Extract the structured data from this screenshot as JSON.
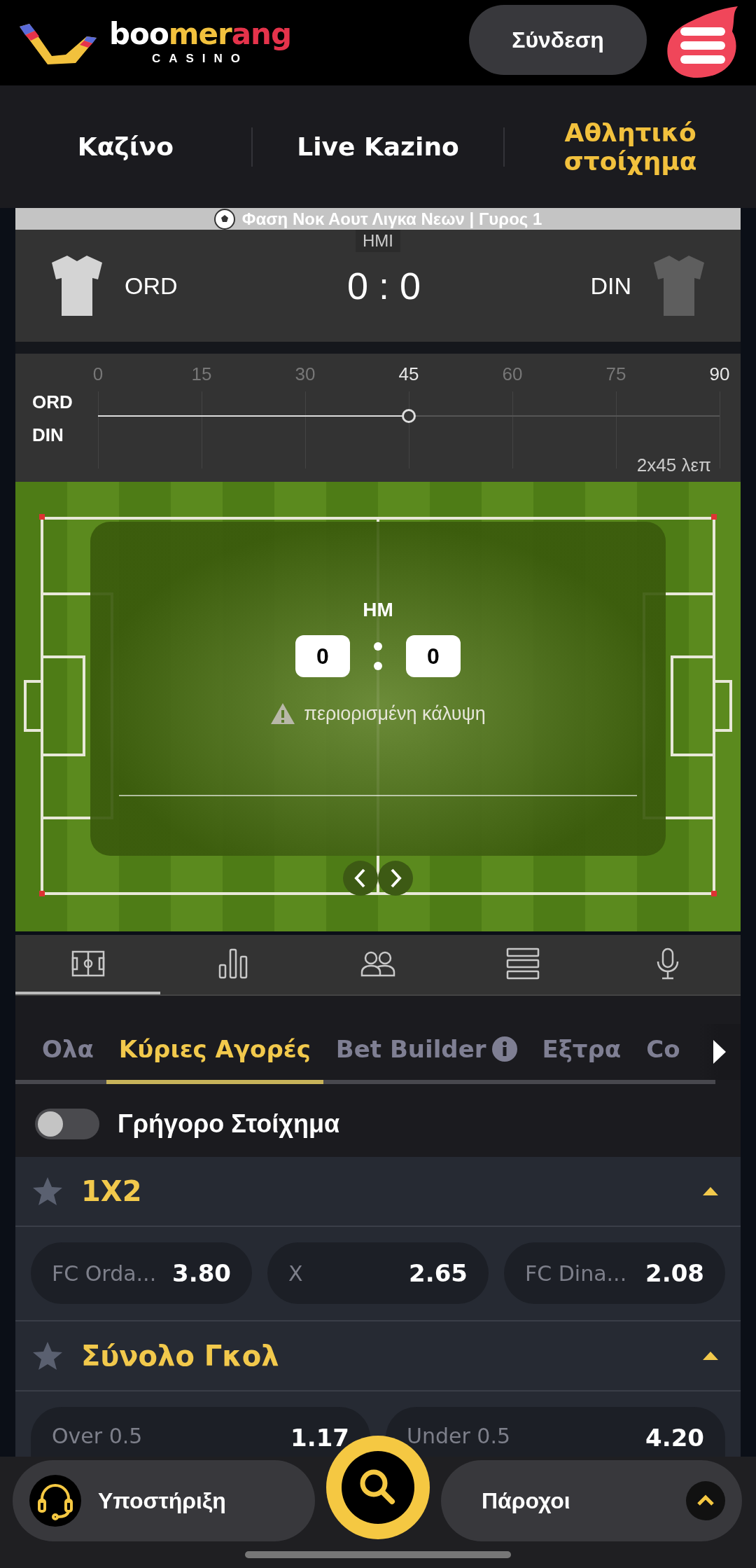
{
  "header": {
    "logo": {
      "parts": [
        "boo",
        "mer",
        "ang"
      ],
      "subtitle": "CASINO"
    },
    "login_button": "Σύνδεση"
  },
  "nav_tabs": [
    {
      "label": "Καζίνο",
      "selected": false
    },
    {
      "label": "Live Kazino",
      "selected": false
    },
    {
      "label": "Αθλητικό στοίχημα",
      "selected": true
    }
  ],
  "match": {
    "league_line": "Φαση Νοκ Αουτ Λιγκα Νεων | Γυρος 1",
    "period": "HMI",
    "score": "0 : 0",
    "teams": [
      {
        "name": "ORD",
        "color": "#d4d4d4"
      },
      {
        "name": "DIN",
        "color": "#5e5e5e"
      }
    ]
  },
  "timeline": {
    "ticks": [
      {
        "label": "0",
        "highlighted": false
      },
      {
        "label": "15",
        "highlighted": false
      },
      {
        "label": "30",
        "highlighted": false
      },
      {
        "label": "45",
        "highlighted": true
      },
      {
        "label": "60",
        "highlighted": false
      },
      {
        "label": "75",
        "highlighted": false
      },
      {
        "label": "90",
        "highlighted": true
      }
    ],
    "rows": [
      "ORD",
      "DIN"
    ],
    "level": 0.5,
    "duration": "2x45 λεπ"
  },
  "pitch_overlay": {
    "period": "HM",
    "home_score": "0",
    "away_score": "0",
    "notice": "περιορισμένη κάλυψη"
  },
  "stat_tabs": [
    {
      "kind": "pitch",
      "selected": true
    },
    {
      "kind": "stats",
      "selected": false
    },
    {
      "kind": "lineups",
      "selected": false
    },
    {
      "kind": "list",
      "selected": false
    },
    {
      "kind": "commentary",
      "selected": false
    }
  ],
  "market_tabs": [
    {
      "label": "Ολα",
      "selected": false,
      "info": false
    },
    {
      "label": "Κύριες Αγορές",
      "selected": true,
      "info": false
    },
    {
      "label": "Bet Builder",
      "selected": false,
      "info": true
    },
    {
      "label": "Εξτρα",
      "selected": false,
      "info": false
    },
    {
      "label": "Co",
      "selected": false,
      "info": false
    }
  ],
  "quick_bet": {
    "label": "Γρήγορο Στοίχημα",
    "on": false
  },
  "markets": [
    {
      "title": "1X2",
      "favorite": false,
      "expanded": true,
      "outcomes": [
        {
          "label": "FC Orda...",
          "odds": "3.80"
        },
        {
          "label": "X",
          "odds": "2.65"
        },
        {
          "label": "FC Dina...",
          "odds": "2.08"
        }
      ]
    },
    {
      "title": "Σύνολο Γκολ",
      "favorite": false,
      "expanded": true,
      "outcomes": [
        {
          "label": "Over 0.5",
          "odds": "1.17"
        },
        {
          "label": "Under 0.5",
          "odds": "4.20"
        }
      ]
    }
  ],
  "bottom_bar": {
    "support": "Υποστήριξη",
    "providers": "Πάροχοι"
  }
}
